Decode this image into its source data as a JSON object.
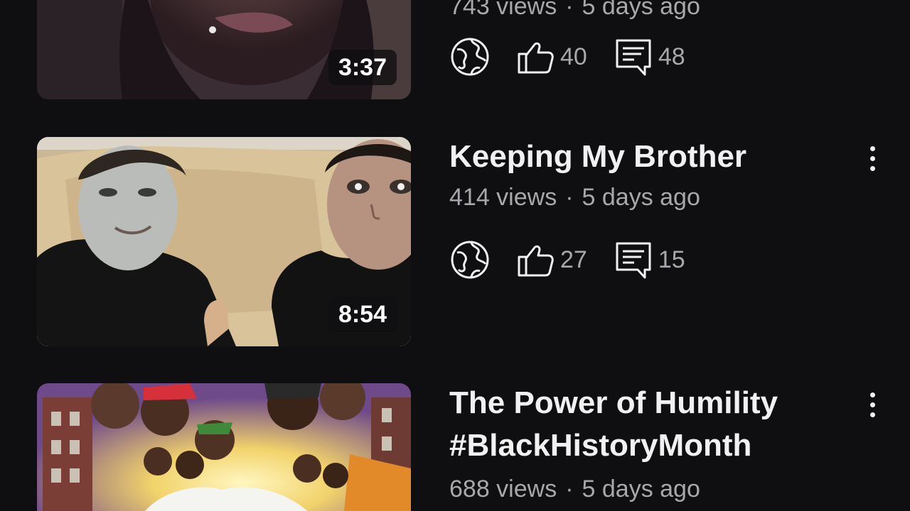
{
  "videos": [
    {
      "title": "",
      "views": "743 views",
      "age": "5 days ago",
      "duration": "3:37",
      "likes": "40",
      "comments": "48",
      "visibility_icon": "globe-icon"
    },
    {
      "title": "Keeping My Brother",
      "views": "414 views",
      "age": "5 days ago",
      "duration": "8:54",
      "likes": "27",
      "comments": "15",
      "visibility_icon": "globe-icon"
    },
    {
      "title_line1": "The Power of Humility",
      "title_line2": "#BlackHistoryMonth",
      "views": "688 views",
      "age": "5 days ago"
    }
  ],
  "separator": "·",
  "icons": {
    "visibility": "globe-icon",
    "like": "thumbs-up-icon",
    "comment": "comment-icon",
    "more": "more-vertical-icon"
  },
  "colors": {
    "background": "#0f0e11",
    "text_primary": "#f1f1f1",
    "text_secondary": "#a8a8ab"
  }
}
